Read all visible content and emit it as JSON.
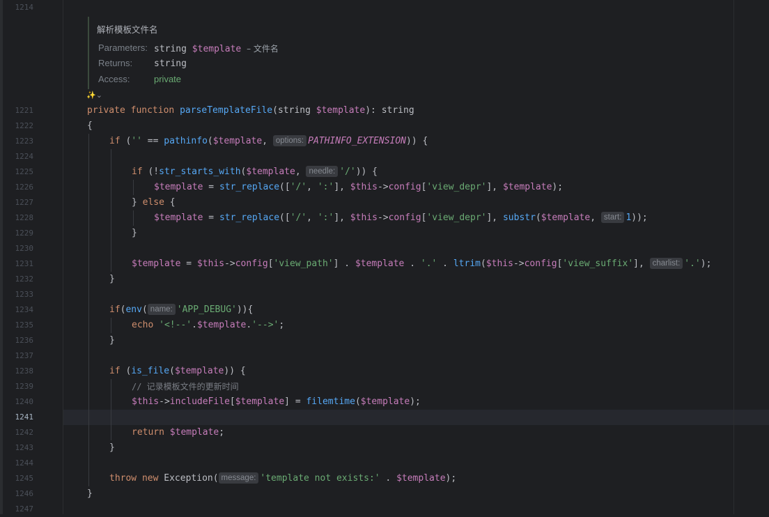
{
  "line_numbers": {
    "first": "1214",
    "lines": [
      "1221",
      "1222",
      "1223",
      "1224",
      "1225",
      "1226",
      "1227",
      "1228",
      "1229",
      "1230",
      "1231",
      "1232",
      "1233",
      "1234",
      "1235",
      "1236",
      "1237",
      "1238",
      "1239",
      "1240",
      "1241",
      "1242",
      "1243",
      "1244",
      "1245",
      "1246",
      "1247"
    ],
    "current": "1241"
  },
  "doc": {
    "title": "解析模板文件名",
    "parameters_label": "Parameters:",
    "param_type": "string",
    "param_var": "$template",
    "param_desc": "– 文件名",
    "returns_label": "Returns:",
    "returns_value": "string",
    "access_label": "Access:",
    "access_value": "private",
    "ai_icon": "✨⌄"
  },
  "code": {
    "l1221": {
      "private": "private",
      "function": "function",
      "name": "parseTemplateFile",
      "p1": "(",
      "type": "string",
      "var": "$template",
      "p2": "): ",
      "ret": "string"
    },
    "l1222": "{",
    "l1223": {
      "if": "if",
      "a": " (",
      "s": "''",
      "b": " == ",
      "fn": "pathinfo",
      "c": "(",
      "var": "$template",
      "d": ", ",
      "hint": "options:",
      "const": "PATHINFO_EXTENSION",
      "e": ")) {"
    },
    "l1225": {
      "if": "if",
      "a": " (!",
      "fn": "str_starts_with",
      "b": "(",
      "var": "$template",
      "c": ", ",
      "hint": "needle:",
      "s": "'/'",
      "d": ")) {"
    },
    "l1226": {
      "var": "$template",
      "a": " = ",
      "fn": "str_replace",
      "b": "([",
      "s1": "'/'",
      "c": ", ",
      "s2": "':'",
      "d": "], ",
      "this": "$this",
      "arrow": "->",
      "prop": "config",
      "e": "[",
      "s3": "'view_depr'",
      "f": "], ",
      "var2": "$template",
      "g": ");"
    },
    "l1227": {
      "a": "} ",
      "else": "else",
      "b": " {"
    },
    "l1228": {
      "var": "$template",
      "a": " = ",
      "fn": "str_replace",
      "b": "([",
      "s1": "'/'",
      "c": ", ",
      "s2": "':'",
      "d": "], ",
      "this": "$this",
      "arrow": "->",
      "prop": "config",
      "e": "[",
      "s3": "'view_depr'",
      "f": "], ",
      "fn2": "substr",
      "g": "(",
      "var2": "$template",
      "h": ", ",
      "hint": "start:",
      "num": "1",
      "i": "));"
    },
    "l1229": "}",
    "l1231": {
      "var": "$template",
      "a": " = ",
      "this": "$this",
      "arrow": "->",
      "prop": "config",
      "b": "[",
      "s1": "'view_path'",
      "c": "] . ",
      "var2": "$template",
      "d": " . ",
      "s2": "'.'",
      "e": " . ",
      "fn": "ltrim",
      "f": "(",
      "this2": "$this",
      "arrow2": "->",
      "prop2": "config",
      "g": "[",
      "s3": "'view_suffix'",
      "h": "], ",
      "hint": "charlist:",
      "s4": "'.'",
      "i": ");"
    },
    "l1232": "}",
    "l1234": {
      "if": "if",
      "a": "(",
      "fn": "env",
      "b": "(",
      "hint": "name:",
      "s": "'APP_DEBUG'",
      "c": ")){"
    },
    "l1235": {
      "echo": "echo",
      "a": " ",
      "s1": "'<!--'",
      "b": ".",
      "var": "$template",
      "c": ".",
      "s2": "'-->'",
      "d": ";"
    },
    "l1236": "}",
    "l1238": {
      "if": "if",
      "a": " (",
      "fn": "is_file",
      "b": "(",
      "var": "$template",
      "c": ")) {"
    },
    "l1239": "// 记录模板文件的更新时间",
    "l1240": {
      "this": "$this",
      "arrow": "->",
      "prop": "includeFile",
      "a": "[",
      "var": "$template",
      "b": "] = ",
      "fn": "filemtime",
      "c": "(",
      "var2": "$template",
      "d": ");"
    },
    "l1242": {
      "ret": "return",
      "a": " ",
      "var": "$template",
      "b": ";"
    },
    "l1243": "}",
    "l1245": {
      "throw": "throw",
      "a": " ",
      "new": "new",
      "b": " Exception(",
      "hint": "message:",
      "s": "'template not exists:'",
      "c": " . ",
      "var": "$template",
      "d": ");"
    },
    "l1246": "}"
  },
  "colors": {
    "background": "#1e1f22",
    "keyword": "#cf8e6d",
    "function": "#56a8f5",
    "variable": "#c77dbb",
    "string": "#6aab73",
    "comment": "#7a7e85"
  }
}
